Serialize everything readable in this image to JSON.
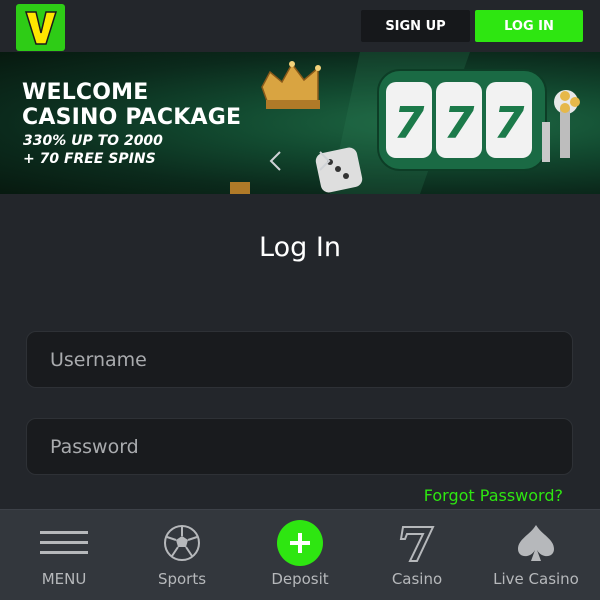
{
  "header": {
    "logo_alt": "V",
    "signup_label": "SIGN UP",
    "login_label": "LOG IN"
  },
  "banner": {
    "title_line1": "WELCOME",
    "title_line2": "CASINO PACKAGE",
    "sub_line1": "330% UP TO 2000",
    "sub_line2": "+ 70 FREE SPINS",
    "icons": [
      "crown-icon",
      "slot-machine-icon",
      "dice-icon",
      "clover-icon"
    ]
  },
  "main": {
    "title": "Log In",
    "username_placeholder": "Username",
    "password_placeholder": "Password",
    "forgot_label": "Forgot Password?"
  },
  "bottom_nav": {
    "items": [
      {
        "label": "MENU",
        "icon": "hamburger-icon"
      },
      {
        "label": "Sports",
        "icon": "soccer-ball-icon"
      },
      {
        "label": "Deposit",
        "icon": "plus-icon"
      },
      {
        "label": "Casino",
        "icon": "seven-icon"
      },
      {
        "label": "Live Casino",
        "icon": "spade-icon"
      }
    ]
  },
  "colors": {
    "accent": "#2ee611",
    "background": "#23262b",
    "nav_background": "#33373d",
    "field_background": "#191b1e"
  }
}
